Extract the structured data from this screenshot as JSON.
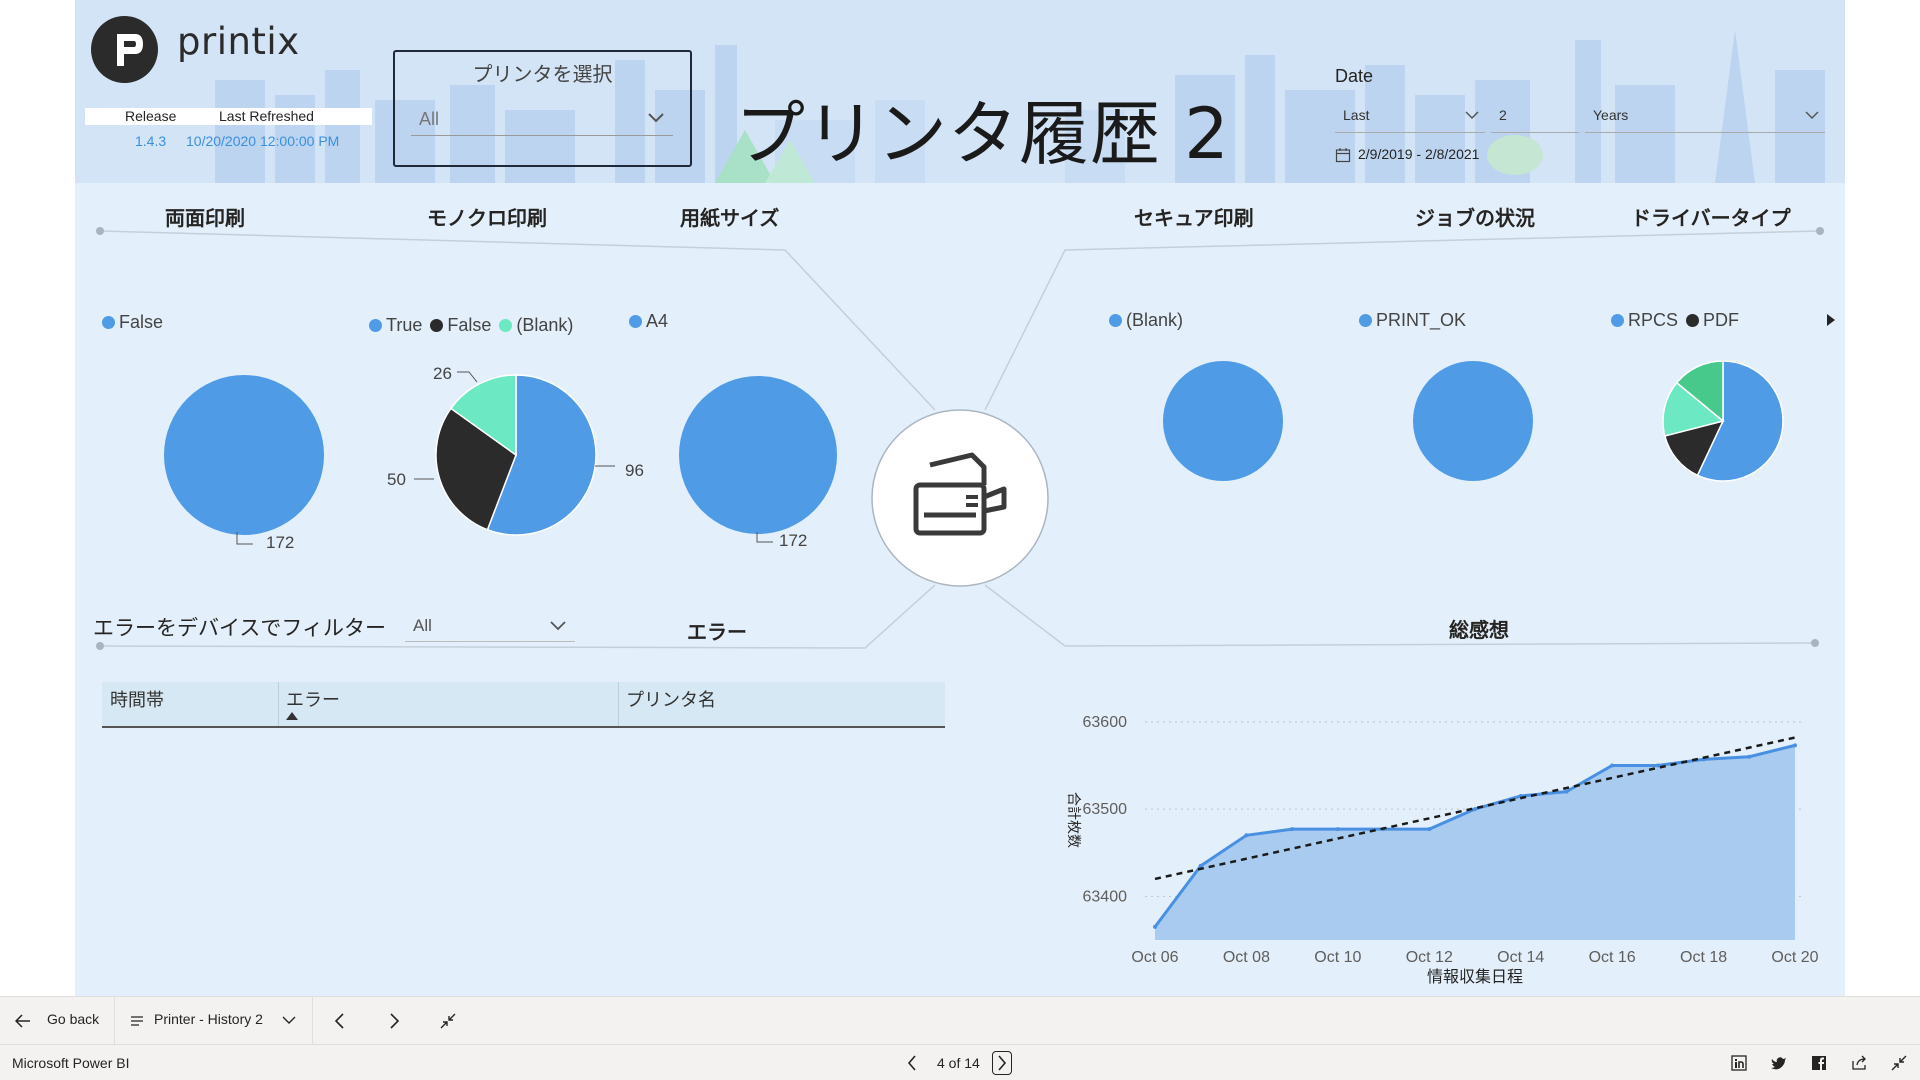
{
  "header": {
    "logo_text": "printix",
    "meta": {
      "release_label": "Release",
      "refreshed_label": "Last Refreshed",
      "release_value": "1.4.3",
      "refreshed_value": "10/20/2020 12:00:00 PM"
    },
    "printer_slicer": {
      "title": "プリンタを選択",
      "value": "All"
    },
    "page_title": "プリンタ履歴 2",
    "date_slicer": {
      "label": "Date",
      "period": "Last",
      "count": "2",
      "unit": "Years",
      "range": "2/9/2019 - 2/8/2021"
    }
  },
  "sections": {
    "duplex": {
      "title": "両面印刷",
      "legend": [
        {
          "name": "False",
          "color": "#4f9be6"
        }
      ],
      "values": [
        172
      ],
      "labels": [
        "172"
      ]
    },
    "mono": {
      "title": "モノクロ印刷",
      "legend": [
        {
          "name": "True",
          "color": "#4f9be6"
        },
        {
          "name": "False",
          "color": "#2b2b2b"
        },
        {
          "name": "(Blank)",
          "color": "#6ce8c2"
        }
      ],
      "values": [
        96,
        50,
        26
      ],
      "labels": [
        "96",
        "50",
        "26"
      ]
    },
    "paper": {
      "title": "用紙サイズ",
      "legend": [
        {
          "name": "A4",
          "color": "#4f9be6"
        }
      ],
      "values": [
        172
      ],
      "labels": [
        "172"
      ]
    },
    "secure": {
      "title": "セキュア印刷",
      "legend": [
        {
          "name": "(Blank)",
          "color": "#4f9be6"
        }
      ],
      "values": [
        1
      ]
    },
    "job": {
      "title": "ジョブの状況",
      "legend": [
        {
          "name": "PRINT_OK",
          "color": "#4f9be6"
        }
      ],
      "values": [
        1
      ]
    },
    "driver": {
      "title": "ドライバータイプ",
      "legend": [
        {
          "name": "RPCS",
          "color": "#4f9be6"
        },
        {
          "name": "PDF",
          "color": "#2b2b2b"
        }
      ],
      "values": [
        57,
        14,
        15,
        14
      ],
      "colors": [
        "#4f9be6",
        "#2b2b2b",
        "#6ce8c2",
        "#46c98b"
      ]
    }
  },
  "errors": {
    "filter_label": "エラーをデバイスでフィルター",
    "filter_value": "All",
    "title": "エラー",
    "table_headers": [
      "時間帯",
      "エラー",
      "プリンタ名"
    ]
  },
  "total": {
    "title": "総感想"
  },
  "chart_data": {
    "type": "area",
    "title": "総感想",
    "xlabel": "情報収集日程",
    "ylabel": "合計枚数",
    "x": [
      "Oct 06",
      "Oct 07",
      "Oct 08",
      "Oct 09",
      "Oct 10",
      "Oct 11",
      "Oct 12",
      "Oct 13",
      "Oct 14",
      "Oct 15",
      "Oct 16",
      "Oct 17",
      "Oct 18",
      "Oct 19",
      "Oct 20"
    ],
    "series": [
      {
        "values": [
          63365,
          63435,
          63470,
          63477,
          63477,
          63477,
          63477,
          63500,
          63515,
          63520,
          63550,
          63550,
          63557,
          63560,
          63573
        ]
      }
    ],
    "trendline": [
      63420,
      63582
    ],
    "xticks": [
      "Oct 06",
      "Oct 08",
      "Oct 10",
      "Oct 12",
      "Oct 14",
      "Oct 16",
      "Oct 18",
      "Oct 20"
    ],
    "yticks": [
      63400,
      63500,
      63600
    ],
    "ylim": [
      63350,
      63625
    ],
    "grid": true,
    "colors": {
      "line": "#4a90e2",
      "fill": "#a9cbf0",
      "trend": "#1a1a1a"
    }
  },
  "navigation": {
    "go_back": "Go back",
    "page_name": "Printer - History 2",
    "app_name": "Microsoft Power BI",
    "page_counter": "4 of 14"
  }
}
